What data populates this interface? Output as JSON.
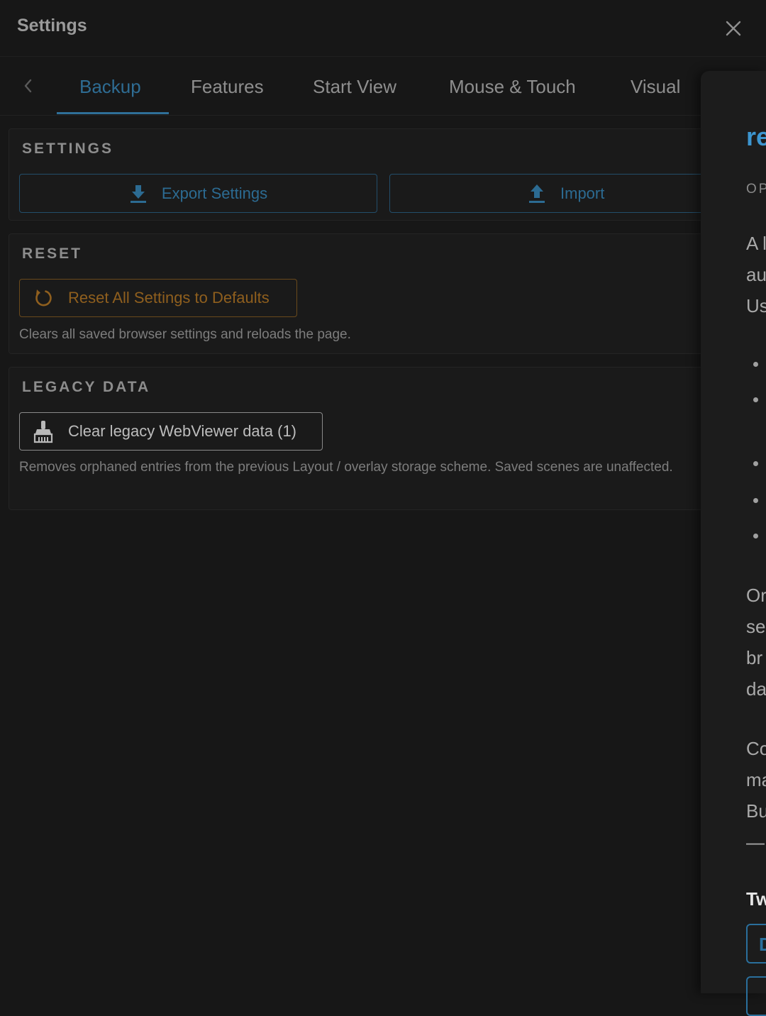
{
  "header": {
    "title": "Settings"
  },
  "tabs": {
    "items": [
      {
        "label": "Backup",
        "active": true
      },
      {
        "label": "Features"
      },
      {
        "label": "Start View"
      },
      {
        "label": "Mouse & Touch"
      },
      {
        "label": "Visual"
      }
    ]
  },
  "settings_section": {
    "title": "SETTINGS",
    "export_label": "Export Settings",
    "import_label": "Import"
  },
  "reset_section": {
    "title": "RESET",
    "button_label": "Reset All Settings to Defaults",
    "hint": "Clears all saved browser settings and reloads the page."
  },
  "legacy_section": {
    "title": "LEGACY DATA",
    "button_label": "Clear legacy WebViewer data (1)",
    "hint": "Removes orphaned entries from the previous Layout / overlay storage scheme. Saved scenes are unaffected."
  },
  "side_panel": {
    "title_fragment": "re",
    "subtitle_fragment": "OP",
    "para1": [
      "A l",
      "au",
      "Us"
    ],
    "para2": [
      "Or",
      "se",
      "br",
      "da"
    ],
    "para3": [
      "Co",
      "ma",
      "Bu",
      "—"
    ],
    "heading_fragment": "Tw",
    "box_fragment": "D"
  },
  "colors": {
    "accent_blue": "#2c6b92",
    "accent_orange": "#8f5f1e",
    "background": "#171717"
  }
}
